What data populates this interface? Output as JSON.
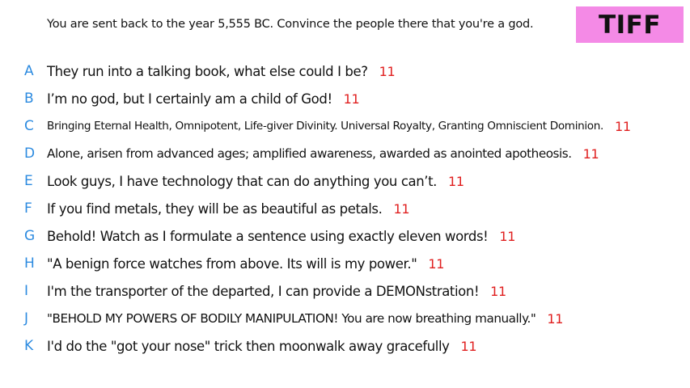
{
  "prompt": "You are sent back to the year 5,555 BC. Convince the people there that you're a god.",
  "badge": {
    "label": "TIFF",
    "color": "#f48ae6"
  },
  "colors": {
    "letter": "#2d8be0",
    "count": "#e02020",
    "text": "#111111"
  },
  "answers": [
    {
      "letter": "A",
      "text": "They run into a talking book, what else could I be?",
      "count": "11"
    },
    {
      "letter": "B",
      "text": "I’m no god, but I certainly am a child of God!",
      "count": "11"
    },
    {
      "letter": "C",
      "text": "Bringing Eternal Health, Omnipotent, Life-giver Divinity. Universal Royalty, Granting Omniscient Dominion.",
      "count": "11"
    },
    {
      "letter": "D",
      "text": "Alone, arisen from advanced ages; amplified awareness, awarded as anointed apotheosis.",
      "count": "11"
    },
    {
      "letter": "E",
      "text": "Look guys, I have technology that can do anything you can’t.",
      "count": "11"
    },
    {
      "letter": "F",
      "text": "If you find metals, they will be as beautiful as petals.",
      "count": "11"
    },
    {
      "letter": "G",
      "text": "Behold! Watch as I formulate a sentence using exactly eleven words!",
      "count": "11"
    },
    {
      "letter": "H",
      "text": "\"A benign force watches from above. Its will is my power.\"",
      "count": "11"
    },
    {
      "letter": "I",
      "text": "I'm the transporter of the departed, I can provide a DEMONstration!",
      "count": "11"
    },
    {
      "letter": "J",
      "text": "\"BEHOLD MY POWERS OF BODILY MANIPULATION! You are now breathing manually.\"",
      "count": "11"
    },
    {
      "letter": "K",
      "text": "I'd do the \"got your nose\" trick then moonwalk away gracefully",
      "count": "11"
    }
  ]
}
